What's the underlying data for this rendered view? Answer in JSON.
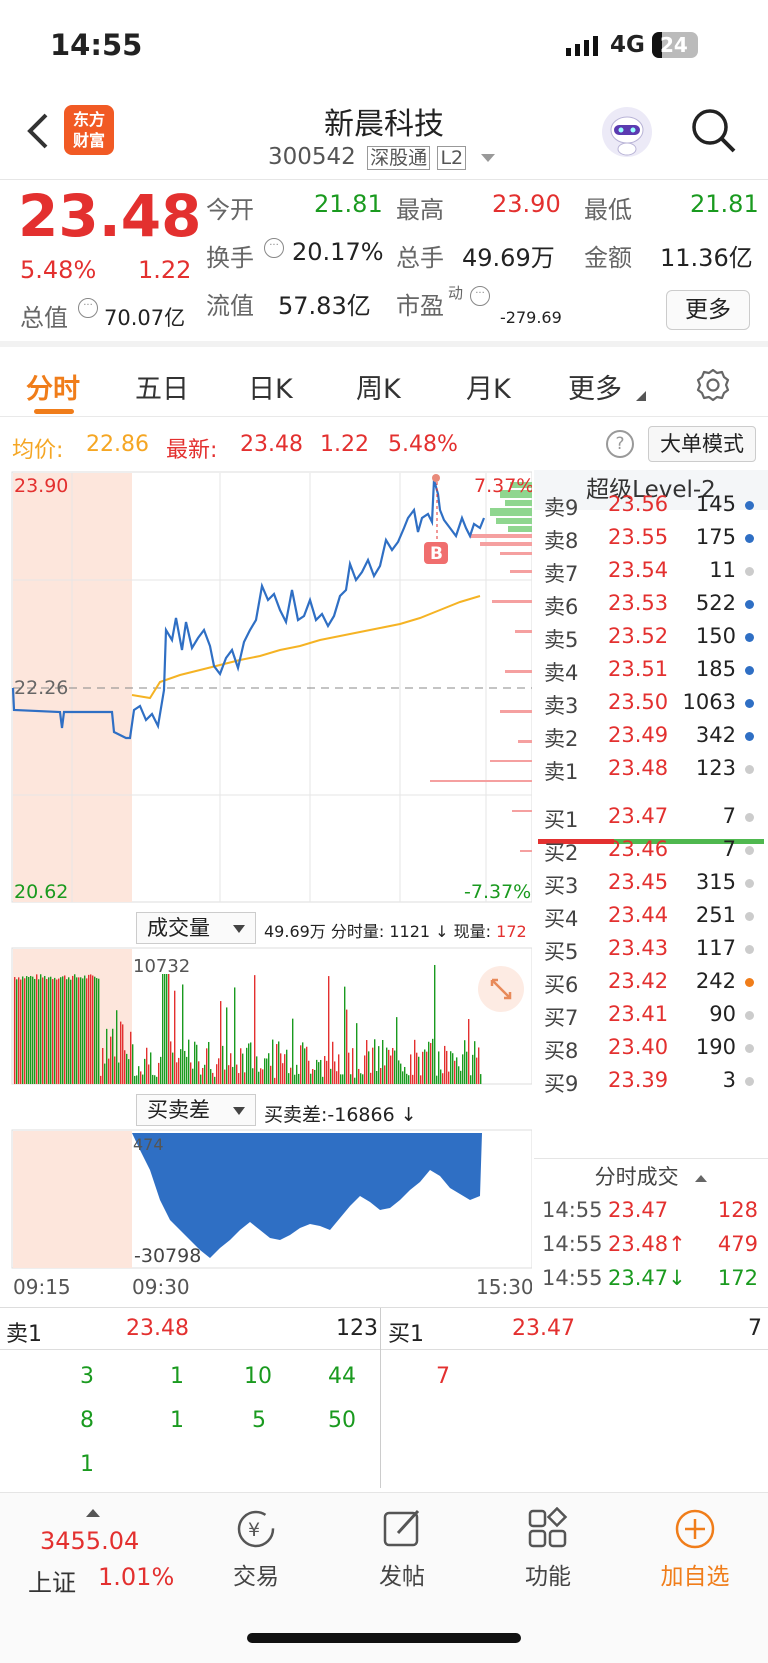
{
  "status": {
    "time": "14:55",
    "network": "4G",
    "battery": "24"
  },
  "header": {
    "back_icon": "chevron-left-icon",
    "logo_line1": "东方",
    "logo_line2": "财富",
    "title": "新晨科技",
    "code": "300542",
    "tag1": "深股通",
    "tag2": "L2",
    "robot_icon": "robot-avatar-icon",
    "search_icon": "search-icon"
  },
  "quote": {
    "price": "23.48",
    "change_pct": "5.48%",
    "change": "1.22",
    "open_label": "今开",
    "open": "21.81",
    "high_label": "最高",
    "high": "23.90",
    "low_label": "最低",
    "low": "21.81",
    "turnover_label": "换手",
    "turnover": "20.17%",
    "volume_label": "总手",
    "volume": "49.69万",
    "amount_label": "金额",
    "amount": "11.36亿",
    "mktcap_label": "总值",
    "mktcap": "70.07亿",
    "float_label": "流值",
    "float_cap": "57.83亿",
    "pe_label": "市盈",
    "pe_sup": "动",
    "pe": "-279.69",
    "more_label": "更多"
  },
  "tabs": [
    "分时",
    "五日",
    "日K",
    "周K",
    "月K",
    "更多"
  ],
  "avg_bar": {
    "avg_label": "均价:",
    "avg": "22.86",
    "latest_label": "最新:",
    "latest": "23.48",
    "chg": "1.22",
    "pct": "5.48%",
    "mode_button": "大单模式"
  },
  "chart": {
    "y_high": "23.90",
    "y_mid": "22.26",
    "y_low": "20.62",
    "pct_high": "7.37%",
    "pct_low": "-7.37%",
    "marker": "B",
    "volume_selector": "成交量",
    "volume_info": "49.69万 分时量: 1121 ↓ 现量:",
    "volume_now": "172",
    "volume_max": "10732",
    "diff_selector": "买卖差",
    "diff_info": "买卖差:-16866 ↓",
    "diff_top": "474",
    "diff_low": "-30798",
    "t_start": "09:15",
    "t_open": "09:30",
    "t_end": "15:30"
  },
  "level2": {
    "title": "超级Level-2",
    "asks": [
      {
        "label": "卖9",
        "price": "23.56",
        "vol": "145"
      },
      {
        "label": "卖8",
        "price": "23.55",
        "vol": "175"
      },
      {
        "label": "卖7",
        "price": "23.54",
        "vol": "11"
      },
      {
        "label": "卖6",
        "price": "23.53",
        "vol": "522"
      },
      {
        "label": "卖5",
        "price": "23.52",
        "vol": "150"
      },
      {
        "label": "卖4",
        "price": "23.51",
        "vol": "185"
      },
      {
        "label": "卖3",
        "price": "23.50",
        "vol": "1063"
      },
      {
        "label": "卖2",
        "price": "23.49",
        "vol": "342"
      },
      {
        "label": "卖1",
        "price": "23.48",
        "vol": "123"
      }
    ],
    "bids": [
      {
        "label": "买1",
        "price": "23.47",
        "vol": "7"
      },
      {
        "label": "买2",
        "price": "23.46",
        "vol": "7"
      },
      {
        "label": "买3",
        "price": "23.45",
        "vol": "315"
      },
      {
        "label": "买4",
        "price": "23.44",
        "vol": "251"
      },
      {
        "label": "买5",
        "price": "23.43",
        "vol": "117"
      },
      {
        "label": "买6",
        "price": "23.42",
        "vol": "242"
      },
      {
        "label": "买7",
        "price": "23.41",
        "vol": "90"
      },
      {
        "label": "买8",
        "price": "23.40",
        "vol": "190"
      },
      {
        "label": "买9",
        "price": "23.39",
        "vol": "3"
      }
    ],
    "trades_title": "分时成交",
    "trades": [
      {
        "time": "14:55",
        "price": "23.47",
        "vol": "128"
      },
      {
        "time": "14:55",
        "price": "23.48↑",
        "vol": "479"
      },
      {
        "time": "14:55",
        "price": "23.47↓",
        "vol": "172"
      }
    ]
  },
  "depth": {
    "sell_label": "卖1",
    "sell_price": "23.48",
    "sell_vol": "123",
    "buy_label": "买1",
    "buy_price": "23.47",
    "buy_vol": "7",
    "sell_orders": [
      "3",
      "1",
      "10",
      "44",
      "8",
      "1",
      "5",
      "50",
      "1"
    ],
    "buy_orders": [
      "7"
    ]
  },
  "bottom": {
    "index_value": "3455.04",
    "index_name": "上证",
    "index_pct": "1.01%",
    "trade": "交易",
    "post": "发帖",
    "func": "功能",
    "add": "加自选"
  },
  "colors": {
    "up": "#e3302f",
    "down": "#1a9a1f",
    "line": "#2f6fc4",
    "avg": "#f5b324",
    "accent": "#f07d1a"
  }
}
